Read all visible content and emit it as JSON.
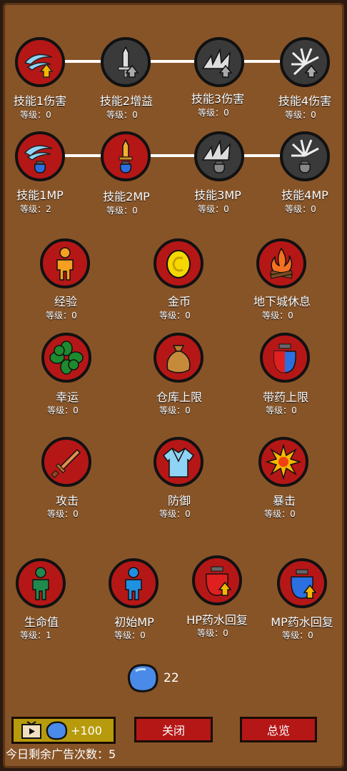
{
  "level_prefix": "等级：",
  "skills_row1": [
    {
      "label": "技能1伤害",
      "level": "等级：0",
      "icon": "slash-wind-up-icon"
    },
    {
      "label": "技能2增益",
      "level": "等级：0",
      "icon": "sword-up-icon"
    },
    {
      "label": "技能3伤害",
      "level": "等级：0",
      "icon": "spikes-up-icon"
    },
    {
      "label": "技能4伤害",
      "level": "等级：0",
      "icon": "burst-up-icon"
    }
  ],
  "skills_row2": [
    {
      "label": "技能1MP",
      "level": "等级：2",
      "icon": "slash-potion-icon"
    },
    {
      "label": "技能2MP",
      "level": "等级：0",
      "icon": "sword-potion-icon"
    },
    {
      "label": "技能3MP",
      "level": "等级：0",
      "icon": "spikes-potion-icon"
    },
    {
      "label": "技能4MP",
      "level": "等级：0",
      "icon": "burst-potion-icon"
    }
  ],
  "attrs_row1": [
    {
      "label": "经验",
      "level": "等级：0",
      "icon": "person-orange-icon"
    },
    {
      "label": "金币",
      "level": "等级：0",
      "icon": "coin-icon"
    },
    {
      "label": "地下城休息",
      "level": "等级：0",
      "icon": "campfire-icon"
    }
  ],
  "attrs_row2": [
    {
      "label": "幸运",
      "level": "等级：0",
      "icon": "clover-icon"
    },
    {
      "label": "仓库上限",
      "level": "等级：0",
      "icon": "bag-icon"
    },
    {
      "label": "带药上限",
      "level": "等级：0",
      "icon": "potion-jar-icon"
    }
  ],
  "attrs_row3": [
    {
      "label": "攻击",
      "level": "等级：0",
      "icon": "sword-icon"
    },
    {
      "label": "防御",
      "level": "等级：0",
      "icon": "armor-icon"
    },
    {
      "label": "暴击",
      "level": "等级：0",
      "icon": "explosion-icon"
    }
  ],
  "attrs_row4": [
    {
      "label": "生命值",
      "level": "等级：1",
      "icon": "person-green-icon"
    },
    {
      "label": "初始MP",
      "level": "等级：0",
      "icon": "person-blue-icon"
    },
    {
      "label": "HP药水回复",
      "level": "等级：0",
      "icon": "hp-potion-up-icon"
    },
    {
      "label": "MP药水回复",
      "level": "等级：0",
      "icon": "mp-potion-up-icon"
    }
  ],
  "gem_count": "22",
  "ad_button": {
    "bonus": "+100"
  },
  "close_button": "关闭",
  "overview_button": "总览",
  "ads_remaining": "今日剩余广告次数：5",
  "colors": {
    "panel": "#875428",
    "node_red": "#b51717",
    "node_dark": "#3a3a3a",
    "ad_button": "#b89b0c"
  }
}
